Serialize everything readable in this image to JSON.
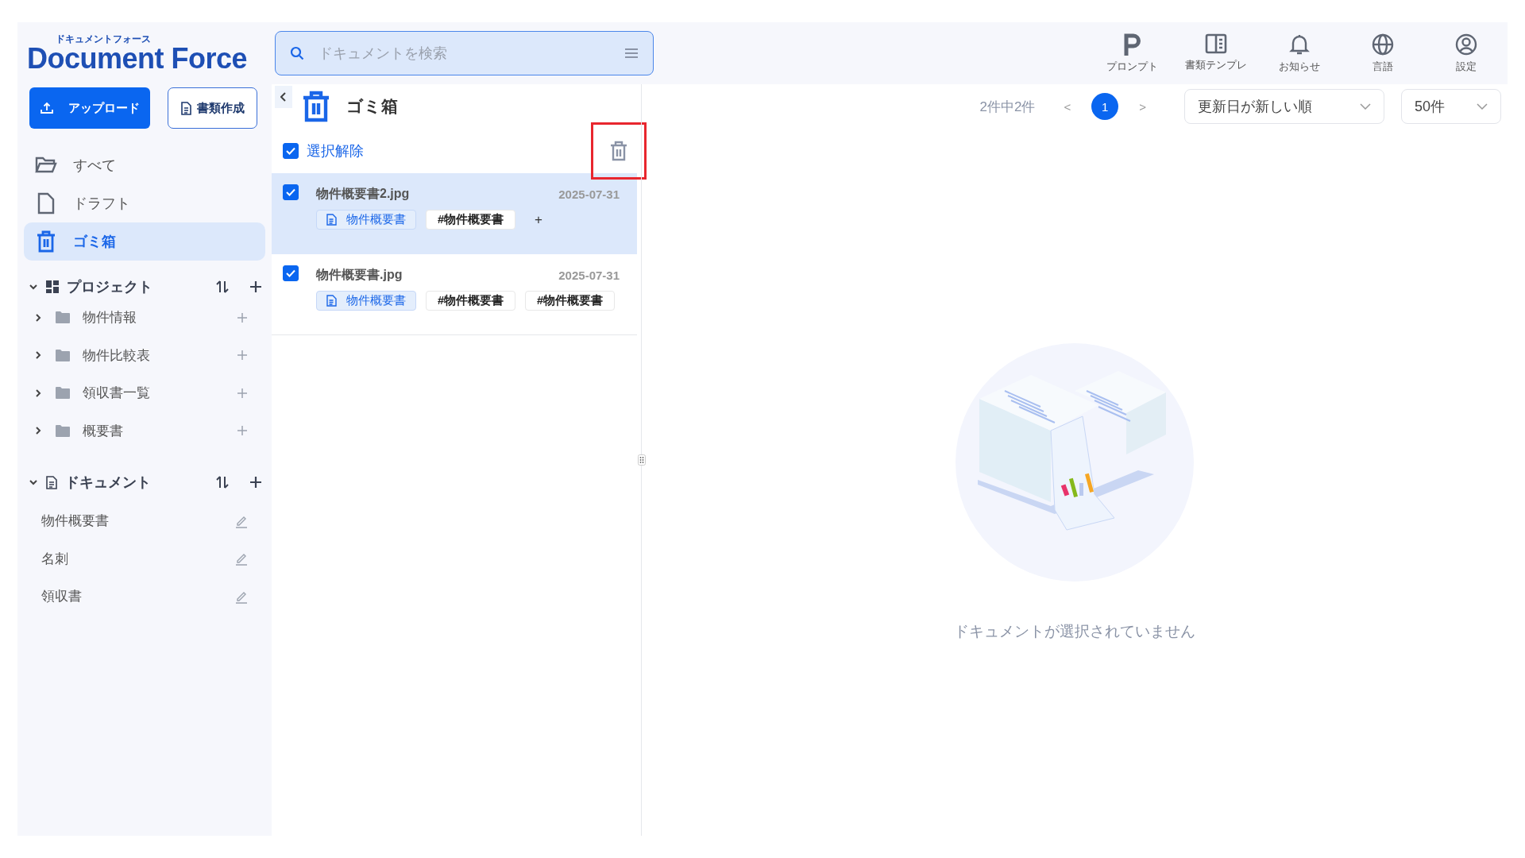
{
  "logo": {
    "kana": "ドキュメントフォース",
    "name": "Document Force"
  },
  "search": {
    "placeholder": "ドキュメントを検索"
  },
  "top_nav": [
    {
      "label": "プロンプト"
    },
    {
      "label": "書類テンプレ"
    },
    {
      "label": "お知らせ"
    },
    {
      "label": "言語"
    },
    {
      "label": "設定"
    }
  ],
  "actions": {
    "upload": "アップロード",
    "create": "書類作成"
  },
  "nav": [
    {
      "label": "すべて",
      "selected": false
    },
    {
      "label": "ドラフト",
      "selected": false
    },
    {
      "label": "ゴミ箱",
      "selected": true
    }
  ],
  "projects": {
    "title": "プロジェクト",
    "expanded": true,
    "items": [
      {
        "label": "物件情報",
        "expanded": false
      },
      {
        "label": "物件比較表",
        "expanded": false
      },
      {
        "label": "領収書一覧",
        "expanded": false
      },
      {
        "label": "概要書",
        "expanded": false
      }
    ]
  },
  "documents": {
    "title": "ドキュメント",
    "expanded": true,
    "items": [
      "物件概要書",
      "名刺",
      "領収書"
    ]
  },
  "list": {
    "title": "ゴミ箱",
    "deselect": {
      "label": "選択解除",
      "checked": true
    },
    "delete_highlighted": true,
    "items": [
      {
        "name": "物件概要書2.jpg",
        "date": "2025-07-31",
        "checked": true,
        "selected": true,
        "category": "物件概要書",
        "tags": [
          "#物件概要書"
        ],
        "add_tag": "+"
      },
      {
        "name": "物件概要書.jpg",
        "date": "2025-07-31",
        "checked": true,
        "selected": false,
        "category": "物件概要書",
        "tags": [
          "#物件概要書",
          "#物件概要書"
        ]
      }
    ]
  },
  "toolbar": {
    "count": "2件中2件",
    "prev": "<",
    "page": "1",
    "next": ">",
    "sort": "更新日が新しい順",
    "per_page": "50件"
  },
  "empty": {
    "message": "ドキュメントが選択されていません"
  }
}
